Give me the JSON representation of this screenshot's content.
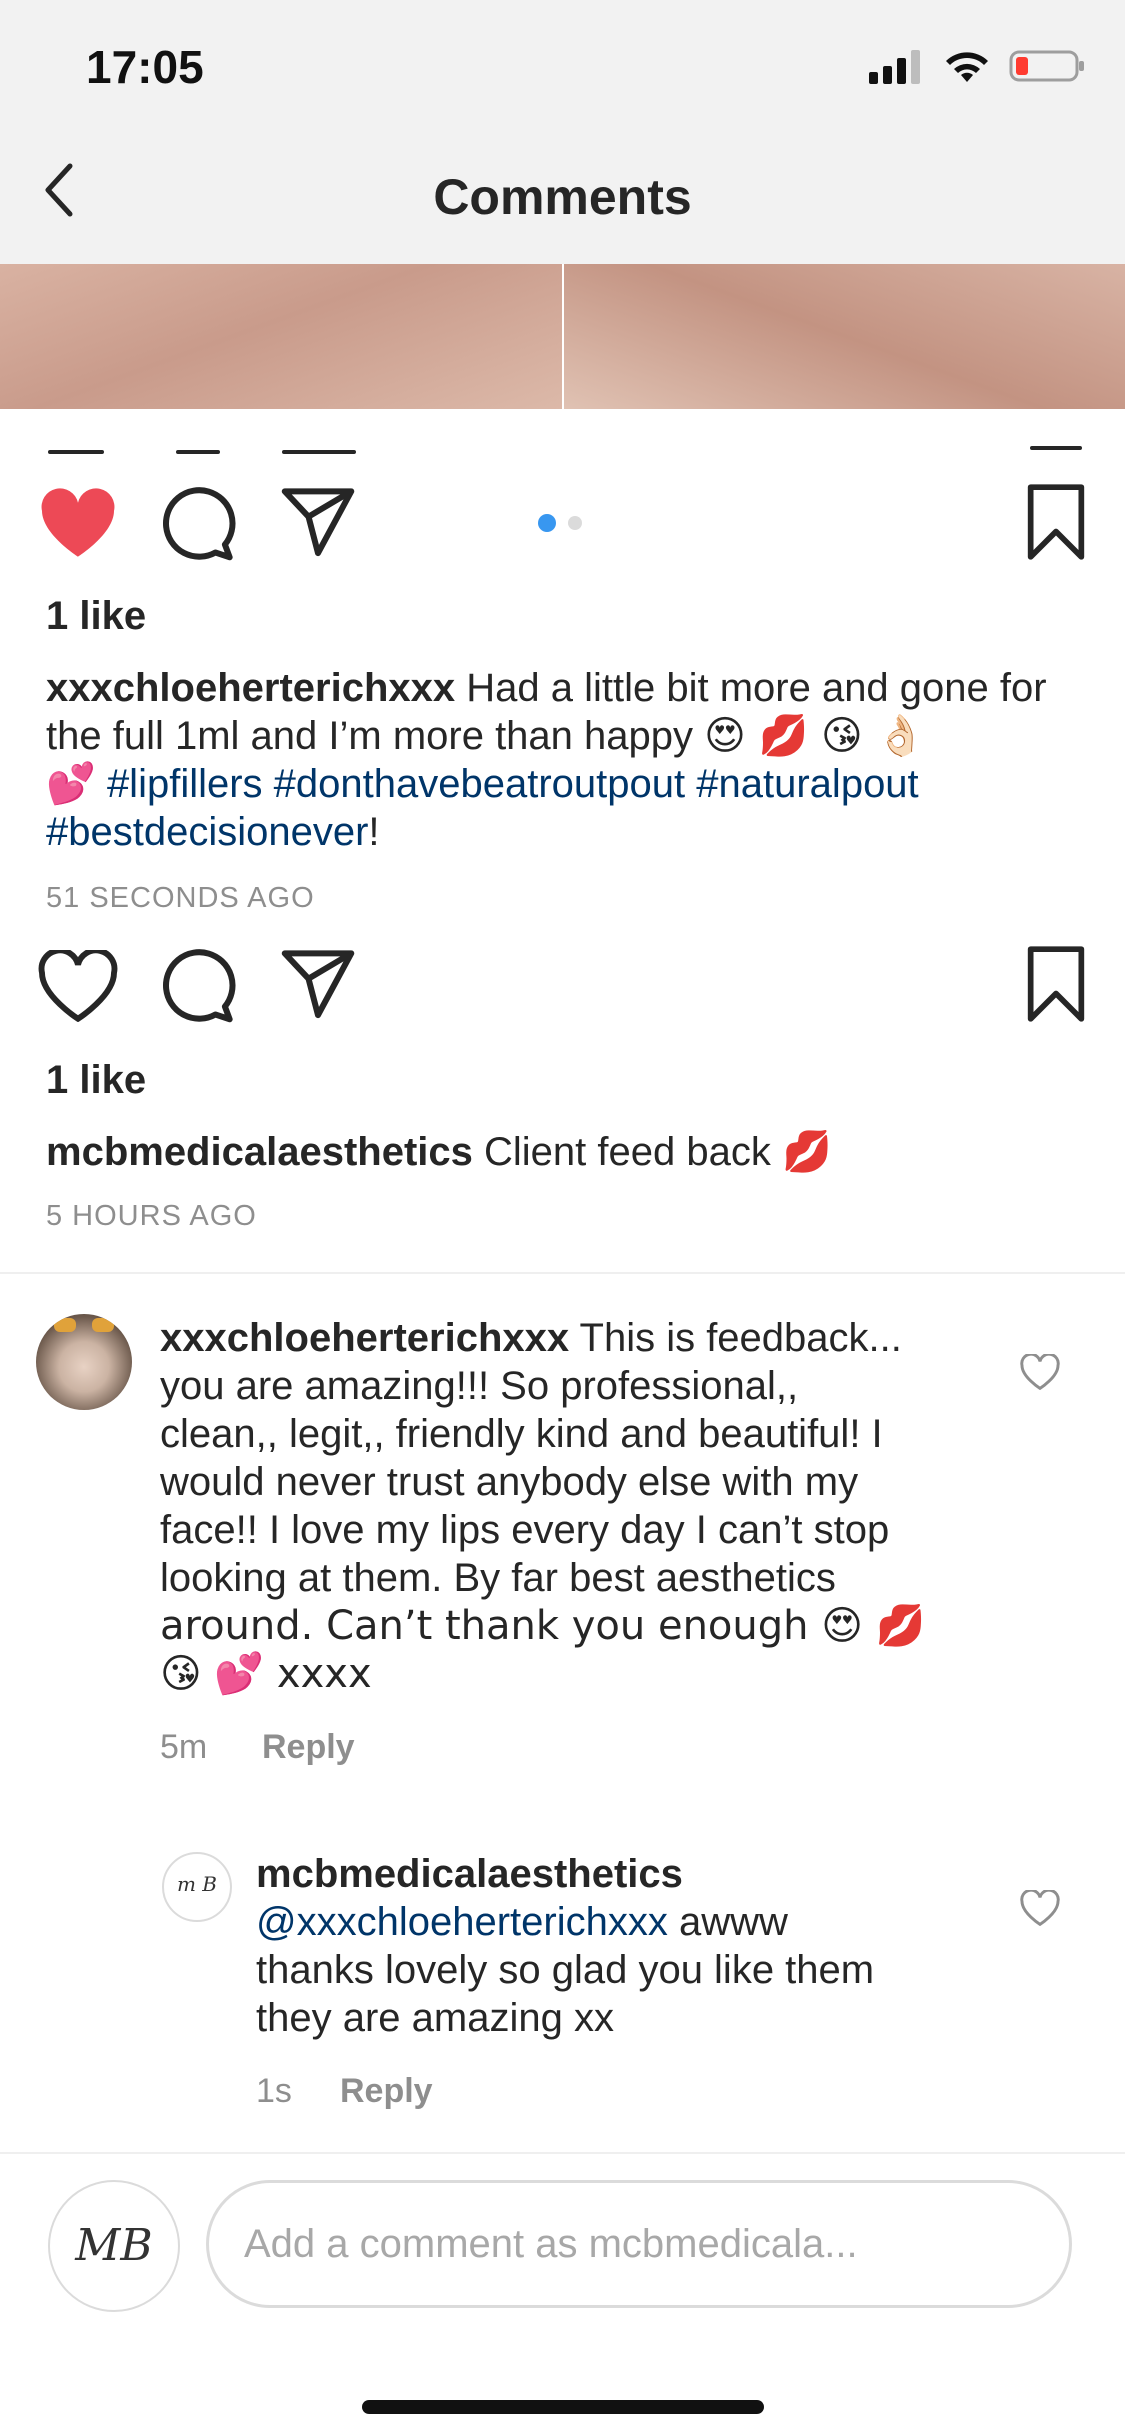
{
  "status": {
    "time": "17:05"
  },
  "header": {
    "title": "Comments"
  },
  "post_photo": {
    "pagination_dots": 2,
    "active_dot": 1
  },
  "post": {
    "likes": "1 like",
    "author": "xxxchloeherterichxxx",
    "caption_text": " Had a little bit more and gone for the full 1ml and I’m more than happy ",
    "caption_emojis": "😍 💋 😘 👌🏻",
    "caption_emoji2": "💕",
    "hashtags": [
      "#lipfillers",
      "#donthavebeatroutpout",
      "#naturalpout",
      "#bestdecisionever"
    ],
    "caption_end": "!",
    "time_ago": "51 SECONDS AGO"
  },
  "repost": {
    "likes": "1 like",
    "author": "mcbmedicalaesthetics",
    "caption_text": " Client feed back ",
    "caption_emoji": "💋",
    "time_ago": "5 HOURS AGO"
  },
  "comments": [
    {
      "author": "xxxchloeherterichxxx",
      "lines": [
        " This is feedback...",
        "you  are amazing!!! So professional,,",
        "clean,, legit,, friendly kind and beautiful! I",
        "would never trust anybody else with my",
        "face!! I love my lips every day I can’t stop",
        "looking at them. By far best aesthetics",
        "around. Can’t thank you enough 😍 💋",
        "😘 💕 xxxx"
      ],
      "time": "5m",
      "reply_label": "Reply"
    },
    {
      "author": "mcbmedicalaesthetics",
      "mention": "@xxxchloeherterichxxx",
      "lines": [
        " awww",
        "thanks lovely so glad you like them",
        "they are amazing xx"
      ],
      "time": "1s",
      "reply_label": "Reply",
      "avatar_text": "m B"
    }
  ],
  "composer": {
    "placeholder": "Add a comment as mcbmedicala...",
    "avatar_text": "MB"
  },
  "colors": {
    "like_red": "#ed4956",
    "hashtag_blue": "#003569",
    "dot_active": "#3897f0",
    "dot_inactive": "#dbdbdb"
  }
}
